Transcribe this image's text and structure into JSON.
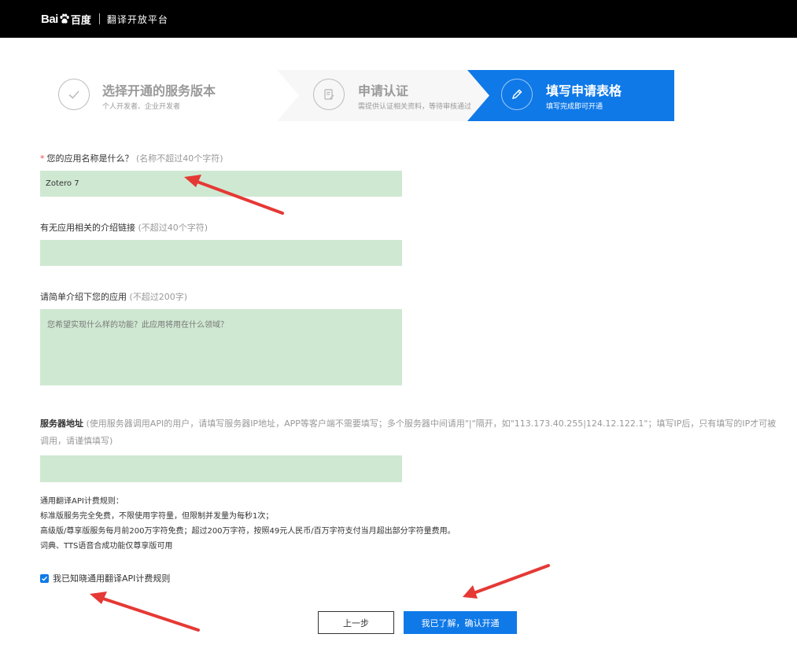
{
  "header": {
    "logo_bai": "Bai",
    "logo_du": "百度",
    "platform_name": "翻译开放平台"
  },
  "steps": [
    {
      "title": "选择开通的服务版本",
      "subtitle": "个人开发者、企业开发者",
      "icon": "check-icon"
    },
    {
      "title": "申请认证",
      "subtitle": "需提供认证相关资料，等待审核通过",
      "icon": "document-edit-icon"
    },
    {
      "title": "填写申请表格",
      "subtitle": "填写完成即可开通",
      "icon": "pencil-icon",
      "active": true
    }
  ],
  "form": {
    "app_name": {
      "required_mark": "*",
      "label": "您的应用名称是什么？",
      "hint": "(名称不超过40个字符)",
      "value": "Zotero 7"
    },
    "intro_link": {
      "label": "有无应用相关的介绍链接",
      "hint": "(不超过40个字符)",
      "value": ""
    },
    "description": {
      "label": "请简单介绍下您的应用",
      "hint": "(不超过200字)",
      "placeholder": "您希望实现什么样的功能？此应用将用在什么领域？"
    },
    "server_address": {
      "label": "服务器地址",
      "hint": "(使用服务器调用API的用户，请填写服务器IP地址，APP等客户端不需要填写；多个服务器中间请用\"|\"隔开，如\"113.173.40.255|124.12.122.1\"；填写IP后，只有填写的IP才可被调用，请谨慎填写)",
      "value": ""
    }
  },
  "billing_rules": [
    "通用翻译API计费规则：",
    "标准版服务完全免费，不限使用字符量，但限制并发量为每秒1次；",
    "高级版/尊享版服务每月前200万字符免费；超过200万字符，按照49元人民币/百万字符支付当月超出部分字符量费用。",
    "词典、TTS语音合成功能仅尊享版可用"
  ],
  "agreement": {
    "checked": true,
    "label": "我已知晓通用翻译API计费规则"
  },
  "buttons": {
    "prev": "上一步",
    "confirm": "我已了解，确认开通"
  },
  "colors": {
    "header_bg": "#000000",
    "accent": "#0f79e8",
    "field_bg": "#cfe8d2",
    "annotation_arrow": "#e53935",
    "required": "#e94b4b"
  }
}
